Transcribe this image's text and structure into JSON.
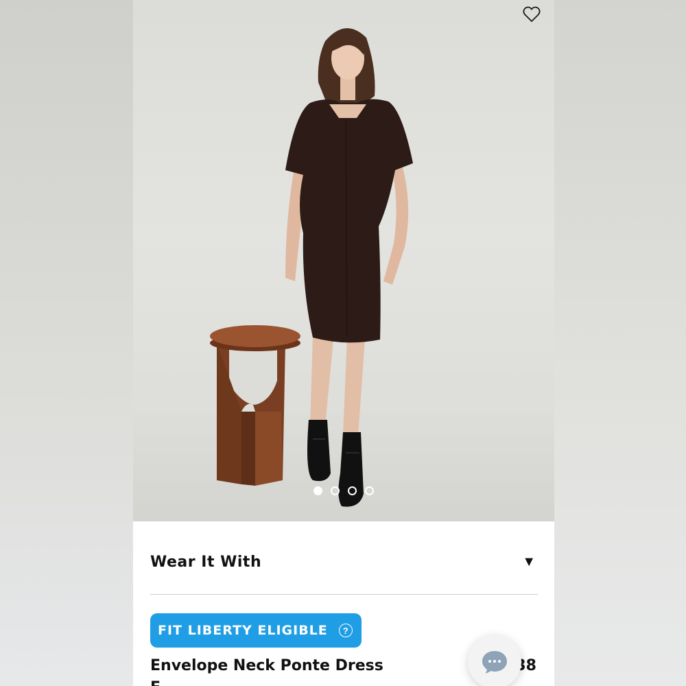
{
  "product_gallery": {
    "favorite_icon": "heart-outline-icon",
    "image_alt": "Model wearing a dark brown short-sleeve sheath dress with black ankle boots, standing beside a wooden stool",
    "slide_count": 4,
    "active_slide": 1
  },
  "wear_it_with": {
    "label": "Wear It With",
    "toggle_icon": "▼"
  },
  "fit_liberty": {
    "label": "FIT LIBERTY ELIGIBLE",
    "help_icon": "?",
    "color": "#1f9ee6"
  },
  "product": {
    "title": "Envelope Neck Ponte Dress",
    "price": "38",
    "subtitle_partial": "F"
  },
  "chat": {
    "icon": "chat-bubble-icon"
  }
}
